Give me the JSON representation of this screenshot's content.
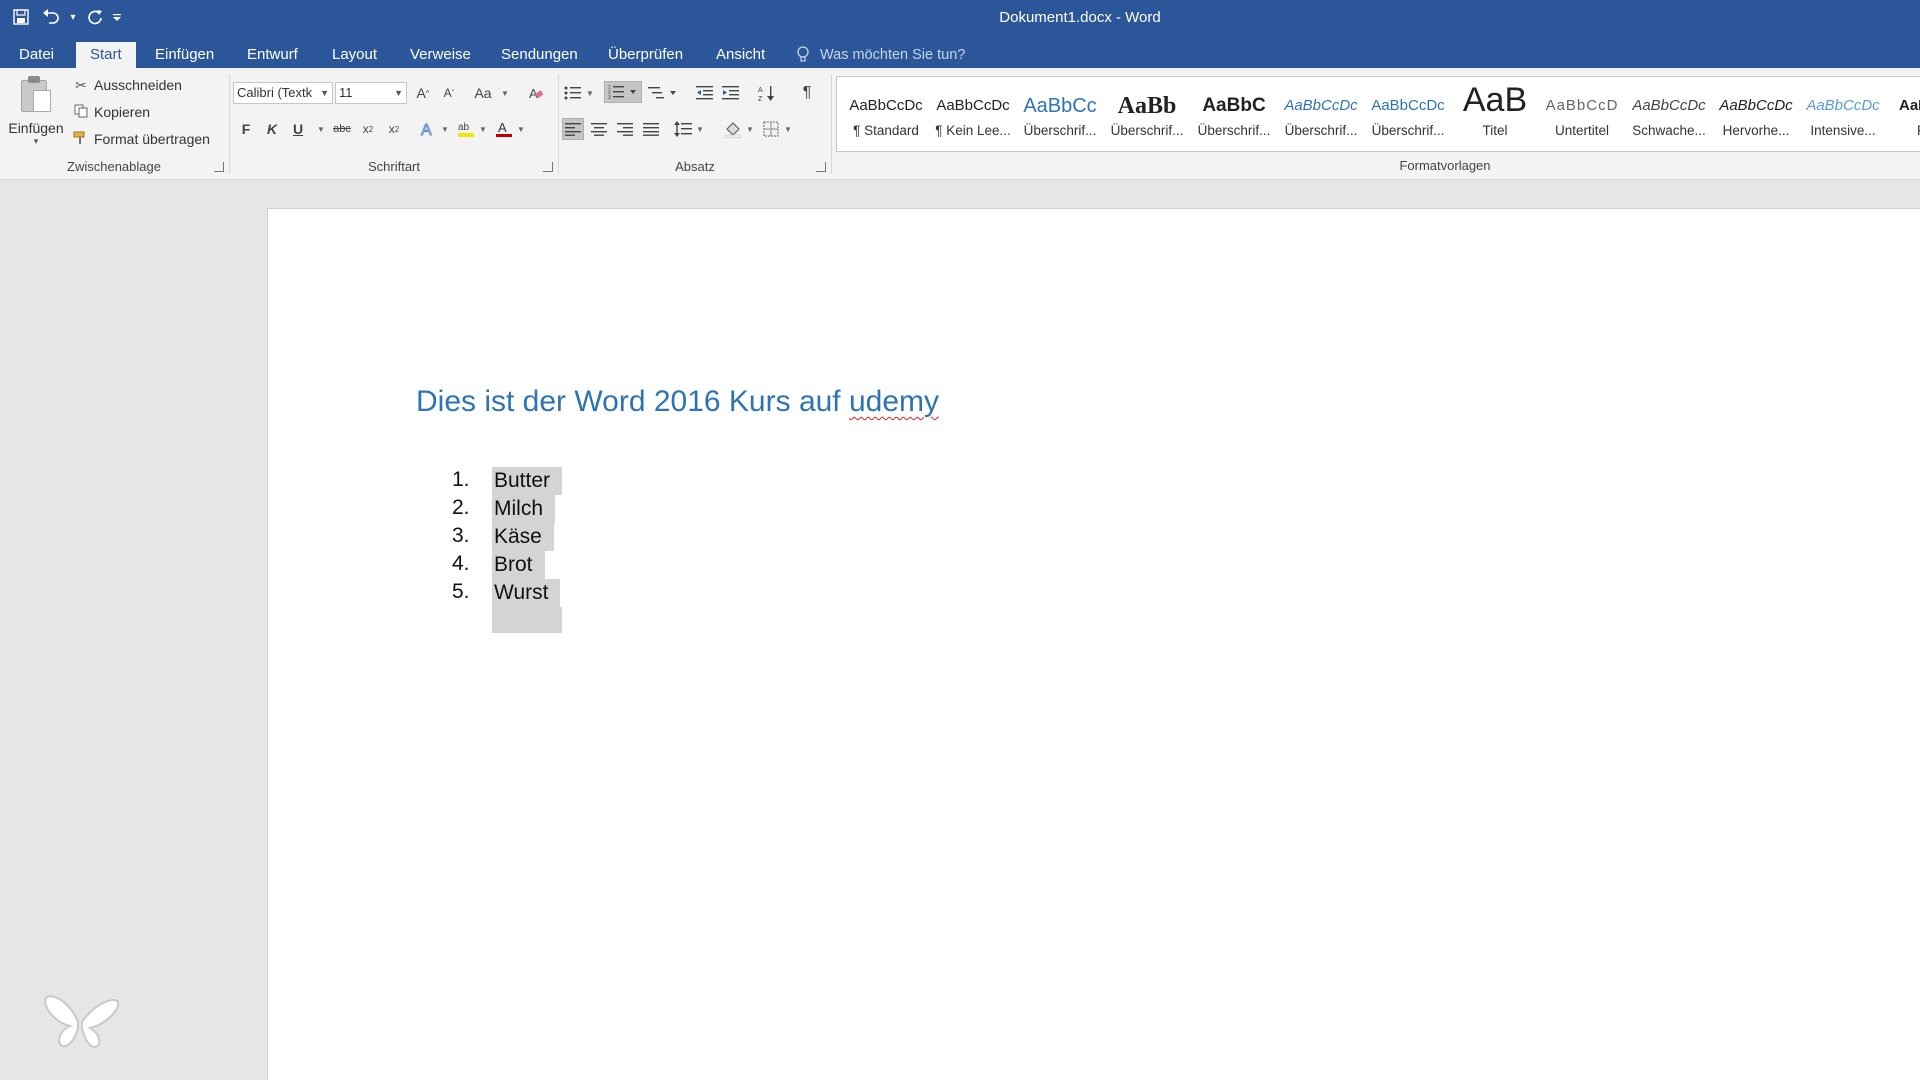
{
  "window": {
    "title": "Dokument1.docx - Word"
  },
  "qat": {
    "save_icon": "save-icon",
    "undo_icon": "undo-icon",
    "redo_icon": "repeat-icon"
  },
  "tabs": [
    "Datei",
    "Start",
    "Einfügen",
    "Entwurf",
    "Layout",
    "Verweise",
    "Sendungen",
    "Überprüfen",
    "Ansicht"
  ],
  "active_tab": "Start",
  "tell_me": "Was möchten Sie tun?",
  "clipboard": {
    "paste": "Einfügen",
    "cut": "Ausschneiden",
    "copy": "Kopieren",
    "format_painter": "Format übertragen",
    "group_label": "Zwischenablage"
  },
  "font": {
    "name": "Calibri (Textk",
    "size": "11",
    "change_case": "Aa",
    "bold": "F",
    "italic": "K",
    "underline": "U",
    "strike": "abc",
    "group_label": "Schriftart",
    "color_accent": "#c00000"
  },
  "paragraph": {
    "group_label": "Absatz"
  },
  "styles": {
    "group_label": "Formatvorlagen",
    "items": [
      {
        "preview": "AaBbCcDc",
        "name": "¶ Standard"
      },
      {
        "preview": "AaBbCcDc",
        "name": "¶ Kein Lee..."
      },
      {
        "preview": "AaBbCc",
        "name": "Überschrif..."
      },
      {
        "preview": "AaBb",
        "name": "Überschrif..."
      },
      {
        "preview": "AaBbC",
        "name": "Überschrif..."
      },
      {
        "preview": "AaBbCcDc",
        "name": "Überschrif..."
      },
      {
        "preview": "AaBbCcDc",
        "name": "Überschrif..."
      },
      {
        "preview": "AaB",
        "name": "Titel"
      },
      {
        "preview": "AaBbCcD",
        "name": "Untertitel"
      },
      {
        "preview": "AaBbCcDc",
        "name": "Schwache..."
      },
      {
        "preview": "AaBbCcDc",
        "name": "Hervorhe..."
      },
      {
        "preview": "AaBbCcDc",
        "name": "Intensive..."
      },
      {
        "preview": "AaBl",
        "name": "Fe"
      }
    ]
  },
  "document": {
    "heading_main": "Dies ist der Word 2016 Kurs auf ",
    "heading_flagged": "udemy",
    "list": [
      {
        "num": "1.",
        "text": "Butter"
      },
      {
        "num": "2.",
        "text": "Milch"
      },
      {
        "num": "3.",
        "text": "Käse"
      },
      {
        "num": "4.",
        "text": "Brot"
      },
      {
        "num": "5.",
        "text": "Wurst"
      }
    ]
  }
}
